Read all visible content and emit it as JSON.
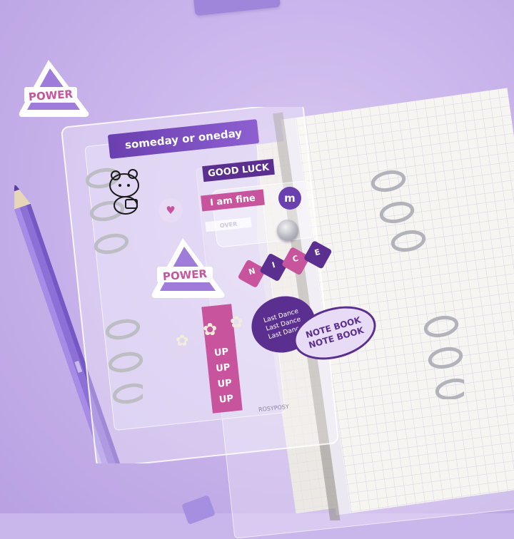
{
  "stickers": {
    "someday": "someday or oneday",
    "good_luck": "GOOD LUCK",
    "i_am_fine": "I am fine",
    "m_badge": "m",
    "power_loose": "POWER",
    "power_binder": "POWER",
    "nice": [
      "N",
      "I",
      "C",
      "E"
    ],
    "last_dance": [
      "Last Dance",
      "Last Dance",
      "Last Dance"
    ],
    "note_book": [
      "NOTE BOOK",
      "NOTE BOOK"
    ],
    "up": [
      "UP",
      "UP",
      "UP",
      "UP"
    ],
    "over": "OVER"
  },
  "brand": "ROSYPOSY",
  "colors": {
    "background": "#c9b6ea",
    "purple_dark": "#5b2f8f",
    "purple_mid": "#8a64c9",
    "pink": "#c8549e",
    "paper": "#f5f3f0",
    "grid": "#d9d6e6",
    "ring_metal": "#b9b9c0"
  }
}
